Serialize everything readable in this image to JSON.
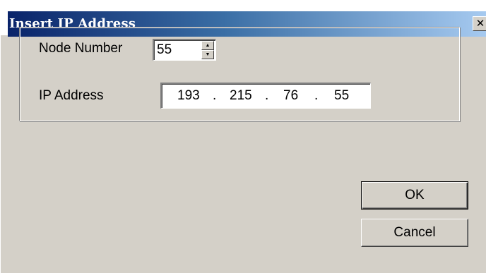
{
  "window": {
    "title": "Insert IP Address",
    "close_glyph": "✕"
  },
  "form": {
    "node_number_label": "Node Number",
    "node_number_value": "55",
    "ip_address_label": "IP Address",
    "ip_octets": [
      "193",
      "215",
      "76",
      "55"
    ],
    "ip_separator": "."
  },
  "buttons": {
    "ok_label": "OK",
    "cancel_label": "Cancel"
  },
  "icons": {
    "close": "close-icon",
    "spin_up": "spin-up-arrow-icon",
    "spin_down": "spin-down-arrow-icon"
  },
  "colors": {
    "titlebar_start": "#0a246a",
    "titlebar_end": "#a6caf0",
    "dialog_background": "#d4d0c8"
  }
}
